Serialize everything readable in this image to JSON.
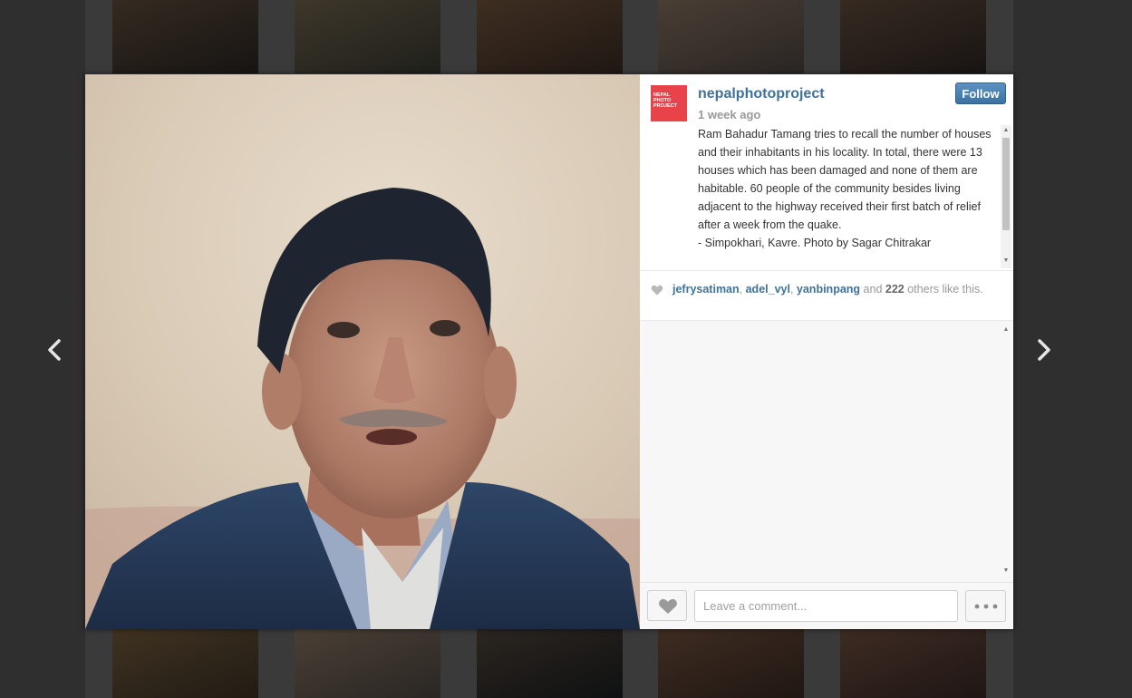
{
  "post": {
    "username": "nepalphotoproject",
    "time_ago": "1 week ago",
    "follow_label": "Follow",
    "avatar_text": "NEPAL\nPHOTO\nPROJECT",
    "caption": "Ram Bahadur Tamang tries to recall the number of houses and their inhabitants in his locality. In total, there were 13 houses which has been damaged and none of them are habitable. 60 people of the community besides living adjacent to the highway received their first batch of relief after a week from the quake.\n- Simpokhari, Kavre. Photo by Sagar Chitrakar",
    "likes": {
      "users": [
        "jefrysatiman",
        "adel_vyl",
        "yanbinpang"
      ],
      "and_text": "and",
      "count": "222",
      "suffix": "others like this."
    }
  },
  "comment": {
    "placeholder": "Leave a comment..."
  },
  "icons": {
    "prev": "chevron-left-icon",
    "next": "chevron-right-icon",
    "like": "heart-icon",
    "more": "ellipsis-icon"
  },
  "colors": {
    "username": "#3f729b",
    "follow_button": "#4a80b0",
    "avatar": "#e8434a",
    "overlay_background": "#2f2f2f"
  }
}
